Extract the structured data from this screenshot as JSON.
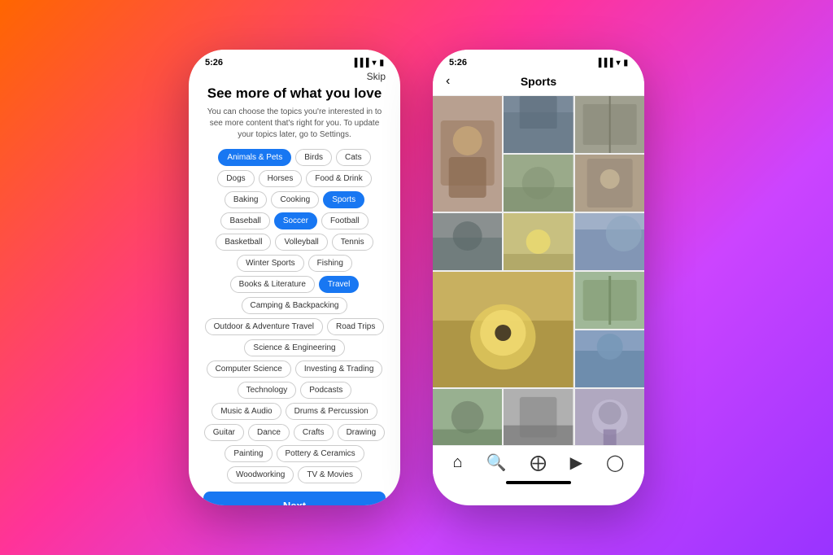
{
  "left_phone": {
    "status_time": "5:26",
    "skip_label": "Skip",
    "title": "See more of what you love",
    "subtitle": "You can choose the topics you're interested in to see more content that's right for you. To update your topics later, go to Settings.",
    "tags": [
      {
        "label": "Animals & Pets",
        "state": "selected-blue"
      },
      {
        "label": "Birds",
        "state": "default"
      },
      {
        "label": "Cats",
        "state": "default"
      },
      {
        "label": "Dogs",
        "state": "default"
      },
      {
        "label": "Horses",
        "state": "default"
      },
      {
        "label": "Food & Drink",
        "state": "default"
      },
      {
        "label": "Baking",
        "state": "default"
      },
      {
        "label": "Cooking",
        "state": "default"
      },
      {
        "label": "Sports",
        "state": "selected-blue"
      },
      {
        "label": "Baseball",
        "state": "default"
      },
      {
        "label": "Soccer",
        "state": "selected-blue"
      },
      {
        "label": "Football",
        "state": "default"
      },
      {
        "label": "Basketball",
        "state": "default"
      },
      {
        "label": "Volleyball",
        "state": "default"
      },
      {
        "label": "Tennis",
        "state": "default"
      },
      {
        "label": "Winter Sports",
        "state": "default"
      },
      {
        "label": "Fishing",
        "state": "default"
      },
      {
        "label": "Books & Literature",
        "state": "default"
      },
      {
        "label": "Travel",
        "state": "selected-blue"
      },
      {
        "label": "Camping & Backpacking",
        "state": "default"
      },
      {
        "label": "Outdoor & Adventure Travel",
        "state": "default"
      },
      {
        "label": "Road Trips",
        "state": "default"
      },
      {
        "label": "Science & Engineering",
        "state": "default"
      },
      {
        "label": "Computer Science",
        "state": "default"
      },
      {
        "label": "Investing & Trading",
        "state": "default"
      },
      {
        "label": "Technology",
        "state": "default"
      },
      {
        "label": "Podcasts",
        "state": "default"
      },
      {
        "label": "Music & Audio",
        "state": "default"
      },
      {
        "label": "Drums & Percussion",
        "state": "default"
      },
      {
        "label": "Guitar",
        "state": "default"
      },
      {
        "label": "Dance",
        "state": "default"
      },
      {
        "label": "Crafts",
        "state": "default"
      },
      {
        "label": "Drawing",
        "state": "default"
      },
      {
        "label": "Painting",
        "state": "default"
      },
      {
        "label": "Pottery & Ceramics",
        "state": "default"
      },
      {
        "label": "Woodworking",
        "state": "default"
      },
      {
        "label": "TV & Movies",
        "state": "default"
      }
    ],
    "next_button": "Next"
  },
  "right_phone": {
    "status_time": "5:26",
    "header_title": "Sports",
    "back_icon": "‹",
    "grid_colors": [
      "#8B6E5A",
      "#5A6E7A",
      "#7A8B6E",
      "#6E7A8B",
      "#8B7A5A",
      "#5A8B6E",
      "#7A6E8B",
      "#8B5A6E",
      "#6E8B7A",
      "#5A7A8B",
      "#8B8B5A",
      "#7A5A8B",
      "#5A8B8B",
      "#8B5A5A",
      "#6E5A8B",
      "#8B6E8B"
    ],
    "nav_icons": [
      "⌂",
      "⌕",
      "⊕",
      "▶",
      "◯"
    ]
  }
}
